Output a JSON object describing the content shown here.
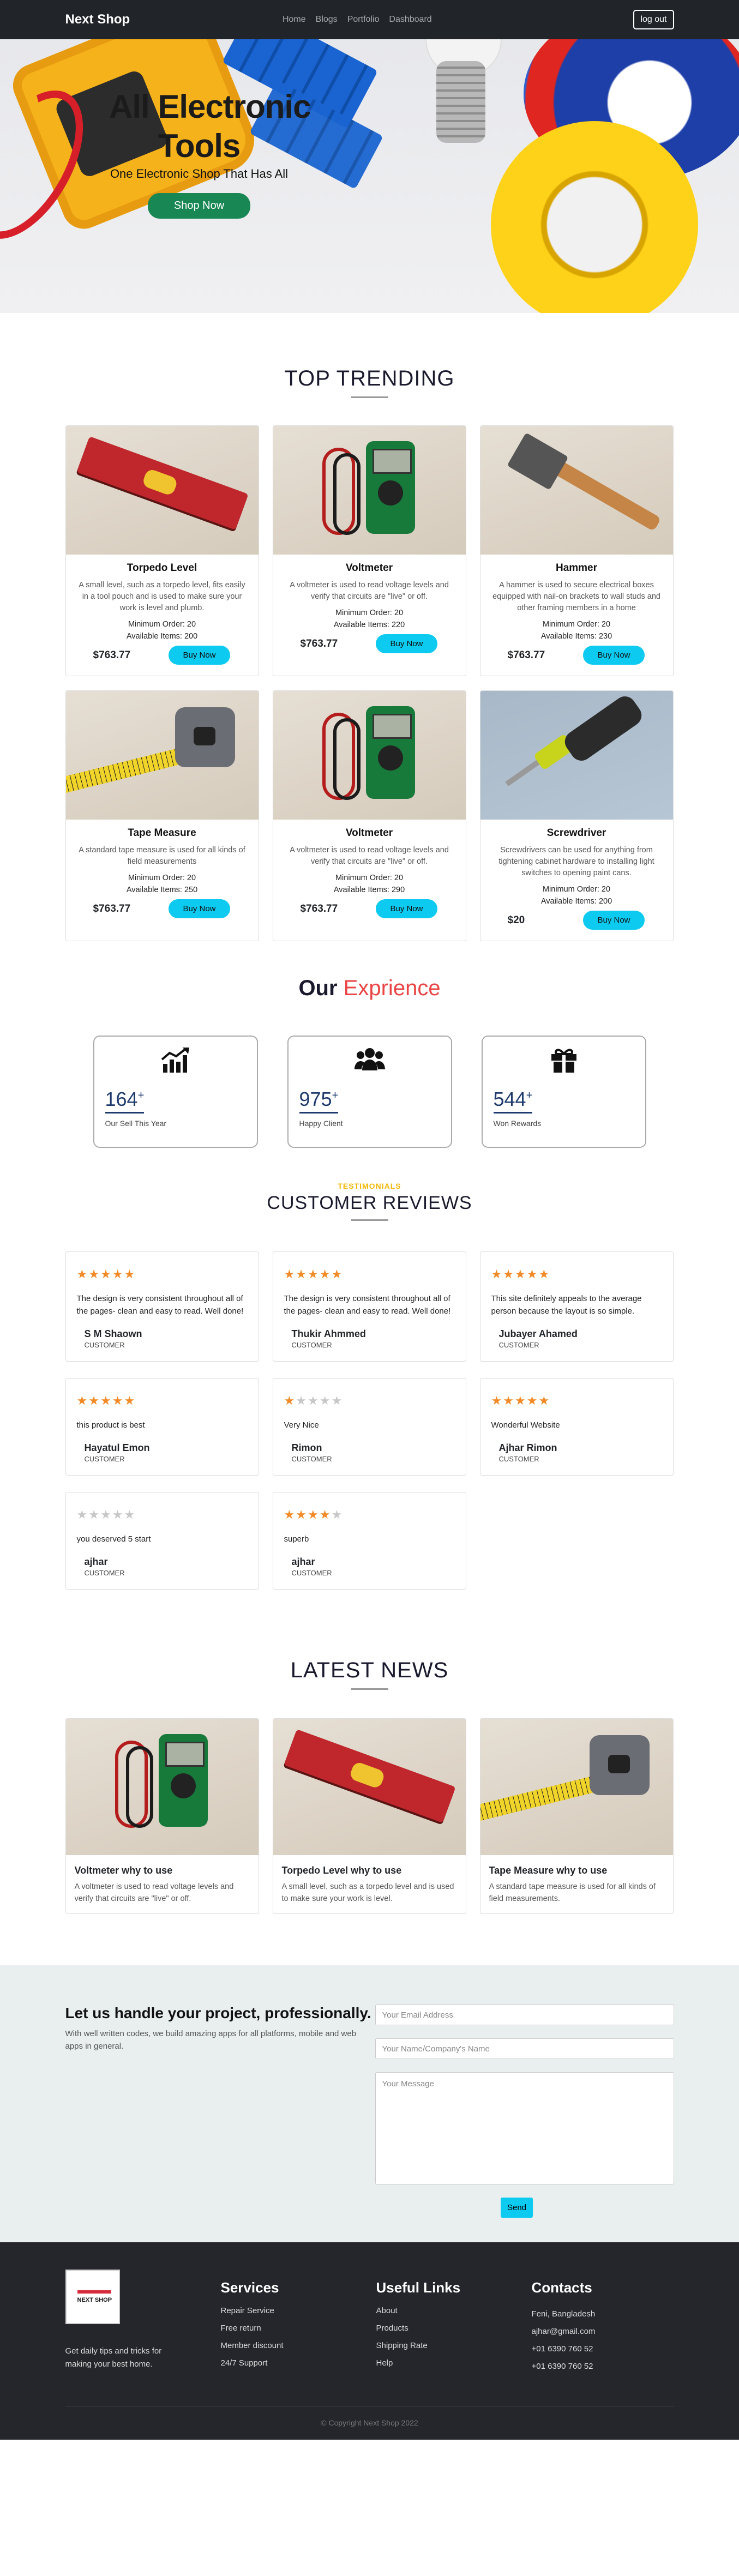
{
  "nav": {
    "brand": "Next Shop",
    "links": [
      "Home",
      "Blogs",
      "Portfolio",
      "Dashboard"
    ],
    "logout": "log out"
  },
  "hero": {
    "title_line1": "All Electronic",
    "title_line2": "Tools",
    "subtitle": "One Electronic Shop That Has All",
    "cta": "Shop Now"
  },
  "trending": {
    "title": "TOP TRENDING",
    "buy_label": "Buy Now",
    "products": [
      {
        "name": "Torpedo Level",
        "desc": "A small level, such as a torpedo level, fits easily in a tool pouch and is used to make sure your work is level and plumb.",
        "min": "Minimum Order: 20",
        "avail": "Available Items: 200",
        "price": "$763.77"
      },
      {
        "name": "Voltmeter",
        "desc": "A voltmeter is used to read voltage levels and verify that circuits are \"live\" or off.",
        "min": "Minimum Order: 20",
        "avail": "Available Items: 220",
        "price": "$763.77"
      },
      {
        "name": "Hammer",
        "desc": "A hammer is used to secure electrical boxes equipped with nail-on brackets to wall studs and other framing members in a home",
        "min": "Minimum Order: 20",
        "avail": "Available Items: 230",
        "price": "$763.77"
      },
      {
        "name": "Tape Measure",
        "desc": "A standard tape measure is used for all kinds of field measurements",
        "min": "Minimum Order: 20",
        "avail": "Available Items: 250",
        "price": "$763.77"
      },
      {
        "name": "Voltmeter",
        "desc": "A voltmeter is used to read voltage levels and verify that circuits are \"live\" or off.",
        "min": "Minimum Order: 20",
        "avail": "Available Items: 290",
        "price": "$763.77"
      },
      {
        "name": "Screwdriver",
        "desc": "Screwdrivers can be used for anything from tightening cabinet hardware to installing light switches to opening paint cans.",
        "min": "Minimum Order: 20",
        "avail": "Available Items: 200",
        "price": "$20"
      }
    ]
  },
  "experience": {
    "title_a": "Our",
    "title_b": "Exprience",
    "accent": "#ea4444",
    "items": [
      {
        "icon": "chart-up-icon",
        "num": "164",
        "label": "Our Sell This Year"
      },
      {
        "icon": "users-icon",
        "num": "975",
        "label": "Happy Client"
      },
      {
        "icon": "gift-icon",
        "num": "544",
        "label": "Won Rewards"
      }
    ]
  },
  "reviews": {
    "kicker": "TESTIMONIALS",
    "title": "CUSTOMER REVIEWS",
    "items": [
      {
        "rating": 5,
        "text": "The design is very consistent throughout all of the pages- clean and easy to read. Well done!",
        "name": "S M Shaown",
        "role": "CUSTOMER"
      },
      {
        "rating": 5,
        "text": "The design is very consistent throughout all of the pages- clean and easy to read. Well done!",
        "name": "Thukir Ahmmed",
        "role": "CUSTOMER"
      },
      {
        "rating": 5,
        "text": "This site definitely appeals to the average person because the layout is so simple.",
        "name": "Jubayer Ahamed",
        "role": "CUSTOMER"
      },
      {
        "rating": 5,
        "text": "this product is best",
        "name": "Hayatul Emon",
        "role": "CUSTOMER"
      },
      {
        "rating": 1,
        "text": "Very Nice",
        "name": "Rimon",
        "role": "CUSTOMER"
      },
      {
        "rating": 5,
        "text": "Wonderful Website",
        "name": "Ajhar Rimon",
        "role": "CUSTOMER"
      },
      {
        "rating": 0,
        "text": "you deserved 5 start",
        "name": "ajhar",
        "role": "CUSTOMER"
      },
      {
        "rating": 4,
        "text": "superb",
        "name": "ajhar",
        "role": "CUSTOMER"
      }
    ]
  },
  "news": {
    "title": "LATEST NEWS",
    "items": [
      {
        "title": "Voltmeter why to use",
        "desc": "A voltmeter is used to read voltage levels and verify that circuits are \"live\" or off."
      },
      {
        "title": "Torpedo Level why to use",
        "desc": "A small level, such as a torpedo level and is used to make sure your work is level."
      },
      {
        "title": "Tape Measure why to use",
        "desc": "A standard tape measure is used for all kinds of field measurements."
      }
    ]
  },
  "contact": {
    "title": "Let us handle your project, professionally.",
    "text": "With well written codes, we build amazing apps for all platforms, mobile and web apps in general.",
    "email_ph": "Your Email Address",
    "name_ph": "Your Name/Company's Name",
    "msg_ph": "Your Message",
    "send": "Send"
  },
  "footer": {
    "logo_text": "NEXT SHOP",
    "tagline": "Get daily tips and tricks for making your best home.",
    "services_title": "Services",
    "services": [
      "Repair Service",
      "Free return",
      "Member discount",
      "24/7 Support"
    ],
    "links_title": "Useful Links",
    "links": [
      "About",
      "Products",
      "Shipping Rate",
      "Help"
    ],
    "contacts_title": "Contacts",
    "contacts": [
      "Feni, Bangladesh",
      "ajhar@gmail.com",
      "+01 6390 760 52",
      "+01 6390 760 52"
    ],
    "copyright": "© Copyright Next Shop 2022"
  }
}
